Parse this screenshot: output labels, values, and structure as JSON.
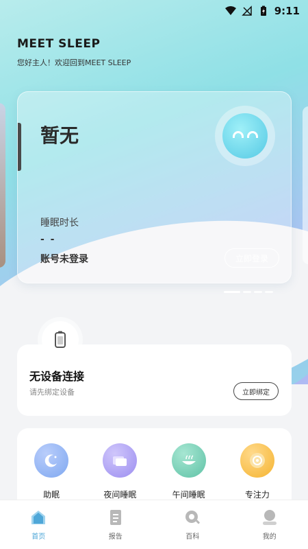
{
  "status_bar": {
    "time": "9:11"
  },
  "header": {
    "app_name": "MEET SLEEP",
    "greeting": "您好主人！欢迎回到MEET SLEEP"
  },
  "sleep_card": {
    "status": "暂无",
    "duration_label": "睡眠时长",
    "duration_value": "- -",
    "account_status": "账号未登录",
    "login_button": "立即登录",
    "carousel_pages": 4,
    "active_page": 1
  },
  "device_card": {
    "title": "无设备连接",
    "subtitle": "请先绑定设备",
    "bind_button": "立即绑定"
  },
  "features": [
    {
      "label": "助眠",
      "icon": "moon-icon",
      "color": "#7fa8f0"
    },
    {
      "label": "夜间睡眠",
      "icon": "night-sleep-icon",
      "color": "#9c8ef0"
    },
    {
      "label": "午间睡眠",
      "icon": "nap-icon",
      "color": "#5fc2a6"
    },
    {
      "label": "专注力",
      "icon": "focus-icon",
      "color": "#f5b431"
    }
  ],
  "bottom_nav": [
    {
      "label": "首页",
      "icon": "home-icon",
      "active": true
    },
    {
      "label": "报告",
      "icon": "report-icon",
      "active": false
    },
    {
      "label": "百科",
      "icon": "encyclopedia-icon",
      "active": false
    },
    {
      "label": "我的",
      "icon": "profile-icon",
      "active": false
    }
  ],
  "colors": {
    "accent": "#4fa7d8",
    "face": "#55c9e4"
  }
}
